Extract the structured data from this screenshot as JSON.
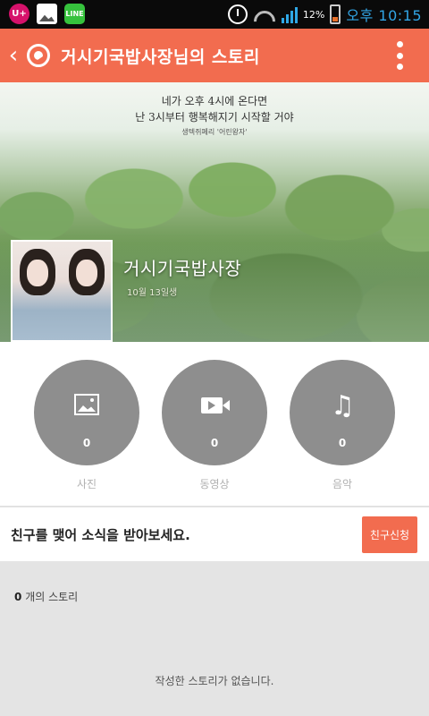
{
  "status_bar": {
    "app_icons": [
      "U+",
      "gallery",
      "LINE"
    ],
    "battery_percent": "12%",
    "time": "오후 10:15",
    "signal_bars": 4
  },
  "app_bar": {
    "title": "거시기국밥사장님의 스토리",
    "color": "#f26c4f"
  },
  "cover": {
    "quote_line1": "네가 오후 4시에 온다면",
    "quote_line2": "난 3시부터 행복해지기 시작할 거야",
    "quote_source": "생텍쥐페리 '어린왕자'",
    "profile_name": "거시기국밥사장",
    "profile_date": "10월 13일생"
  },
  "media": {
    "items": [
      {
        "icon": "photo-icon",
        "count": "0",
        "label": "사진"
      },
      {
        "icon": "video-icon",
        "count": "0",
        "label": "동영상"
      },
      {
        "icon": "music-icon",
        "count": "0",
        "label": "음악"
      }
    ]
  },
  "friend": {
    "message": "친구를 맺어 소식을 받아보세요.",
    "button_label": "친구신청"
  },
  "stories": {
    "count": "0",
    "count_suffix": "개의 스토리",
    "empty_message": "작성한 스토리가 없습니다."
  }
}
